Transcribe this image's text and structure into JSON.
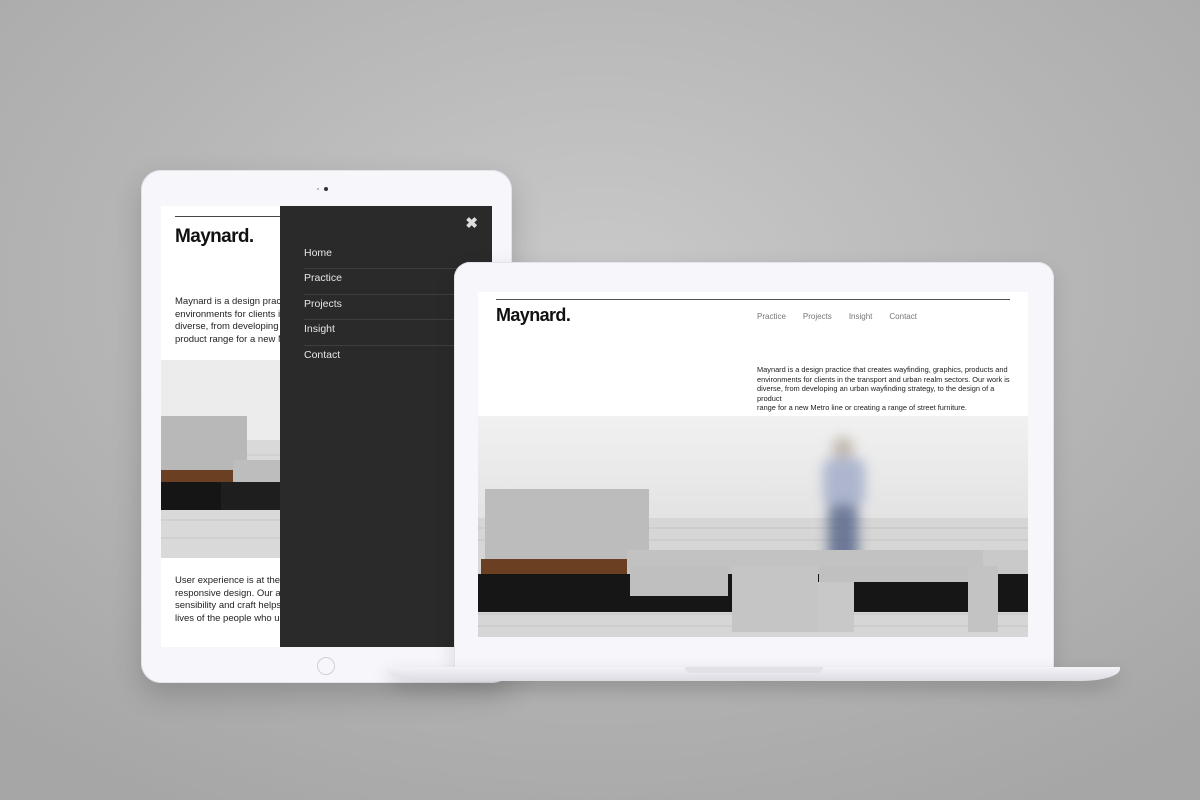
{
  "brand": {
    "logo": "Maynard."
  },
  "tablet": {
    "intro_lines": [
      "Maynard is a design practic",
      "environments for clients in t",
      "diverse, from developing ar",
      "product range for a new Metr"
    ],
    "body_lines": [
      "User experience is at the he",
      "responsive design. Our abil",
      "sensibility and craft helps u",
      "lives of the people who use"
    ],
    "menu": {
      "close_glyph": "✖",
      "items": [
        "Home",
        "Practice",
        "Projects",
        "Insight",
        "Contact"
      ]
    }
  },
  "laptop": {
    "nav": [
      "Practice",
      "Projects",
      "Insight",
      "Contact"
    ],
    "intro_lines": [
      "Maynard is a design practice that creates wayfinding, graphics, products and",
      "environments for clients in the transport and urban realm sectors. Our work is",
      "diverse, from developing an urban wayfinding strategy, to the design of a product",
      "range for a new Metro line or creating a range of street furniture."
    ]
  },
  "colors": {
    "background": "#b8b8b8",
    "device": "#f7f6fb",
    "menu_bg": "#2a2a2a",
    "menu_text": "#e6e6e6",
    "wood": "#6b3f22",
    "concrete": "#b9b9b9"
  }
}
